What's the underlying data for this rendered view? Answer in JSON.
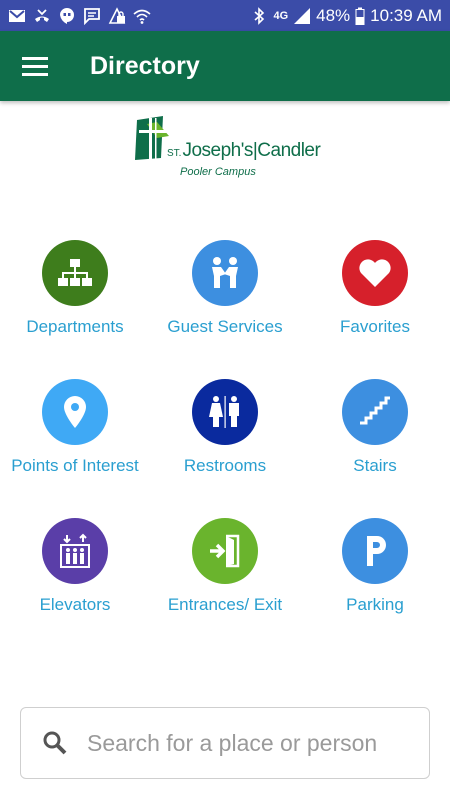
{
  "status_bar": {
    "battery": "48%",
    "time": "10:39 AM",
    "network": "4G"
  },
  "app_bar": {
    "title": "Directory"
  },
  "logo": {
    "st": "ST.",
    "name": "Joseph's|Candler",
    "subtitle": "Pooler Campus"
  },
  "tiles": [
    {
      "label": "Departments",
      "color": "#3e7d1c",
      "icon": "org-chart-icon"
    },
    {
      "label": "Guest Services",
      "color": "#3d8fe0",
      "icon": "handshake-icon"
    },
    {
      "label": "Favorites",
      "color": "#d6202b",
      "icon": "heart-icon"
    },
    {
      "label": "Points of Interest",
      "color": "#3fa9f5",
      "icon": "location-pin-icon"
    },
    {
      "label": "Restrooms",
      "color": "#0a2a9e",
      "icon": "restroom-icon"
    },
    {
      "label": "Stairs",
      "color": "#3d8fe0",
      "icon": "stairs-icon"
    },
    {
      "label": "Elevators",
      "color": "#5a3ea8",
      "icon": "elevator-icon"
    },
    {
      "label": "Entrances/ Exit",
      "color": "#6ab42d",
      "icon": "exit-door-icon"
    },
    {
      "label": "Parking",
      "color": "#3d8fe0",
      "icon": "parking-icon"
    }
  ],
  "search": {
    "placeholder": "Search for a place or person"
  },
  "colors": {
    "status_bar": "#3b4ca8",
    "app_bar": "#0f6e4a",
    "label": "#2a9fd0"
  }
}
